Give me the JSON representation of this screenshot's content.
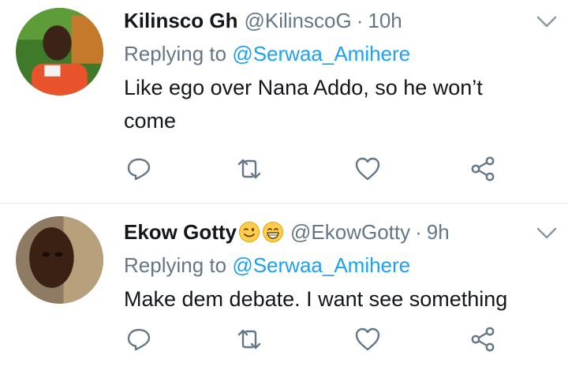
{
  "tweets": [
    {
      "name": "Kilinsco Gh",
      "handle": "@KilinscoG",
      "separator": "·",
      "time": "10h",
      "replying_prefix": "Replying to",
      "replying_to": "@Serwaa_Amihere",
      "text_line1": "Like ego over Nana Addo, so he won’t",
      "text_line2": "come",
      "name_emojis": []
    },
    {
      "name": "Ekow Gotty",
      "handle": "@EkowGotty",
      "separator": "·",
      "time": "9h",
      "replying_prefix": "Replying to",
      "replying_to": "@Serwaa_Amihere",
      "text_line1": "Make dem debate. I want see something",
      "name_emojis": [
        "wink-emoji",
        "grin-emoji"
      ]
    }
  ],
  "icons": {
    "reply": "reply-icon",
    "retweet": "retweet-icon",
    "like": "heart-icon",
    "share": "share-icon",
    "menu": "chevron-down-icon"
  },
  "colors": {
    "text": "#14171a",
    "secondary": "#657786",
    "mention": "#1da1f2",
    "divider": "#e1e8ed"
  }
}
